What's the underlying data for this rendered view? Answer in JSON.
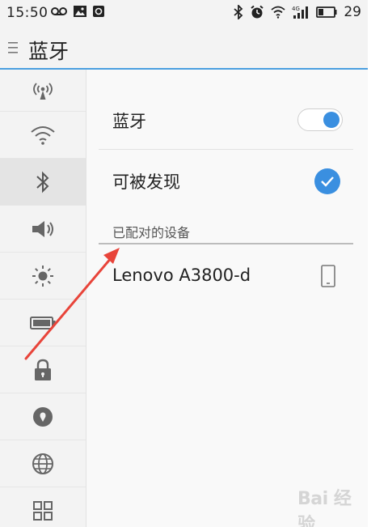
{
  "status_bar": {
    "time": "15:50",
    "battery_level": "29",
    "left_icons": [
      "voicemail-icon",
      "image-icon",
      "app-notification-icon"
    ],
    "right_icons": [
      "bluetooth-icon",
      "alarm-icon",
      "wifi-icon",
      "signal-4g-icon",
      "battery-icon"
    ]
  },
  "header": {
    "title": "蓝牙"
  },
  "sidebar": {
    "items": [
      {
        "name": "hotspot",
        "icon": "hotspot-icon"
      },
      {
        "name": "wifi",
        "icon": "wifi-icon"
      },
      {
        "name": "bluetooth",
        "icon": "bluetooth-icon",
        "active": true
      },
      {
        "name": "sound",
        "icon": "speaker-icon"
      },
      {
        "name": "display",
        "icon": "brightness-icon"
      },
      {
        "name": "battery",
        "icon": "battery-icon"
      },
      {
        "name": "security",
        "icon": "lock-icon"
      },
      {
        "name": "location",
        "icon": "location-pin-icon"
      },
      {
        "name": "language",
        "icon": "globe-icon"
      },
      {
        "name": "apps",
        "icon": "grid-icon"
      }
    ]
  },
  "main": {
    "bluetooth_label": "蓝牙",
    "bluetooth_enabled": true,
    "discoverable_label": "可被发现",
    "discoverable_checked": true,
    "paired_section_title": "已配对的设备",
    "paired_devices": [
      {
        "name": "Lenovo A3800-d",
        "icon": "phone-device-icon"
      }
    ]
  },
  "accent_color": "#3a8fe0",
  "annotation_arrow_color": "#e8443a",
  "watermark_text": "Bai 经验"
}
